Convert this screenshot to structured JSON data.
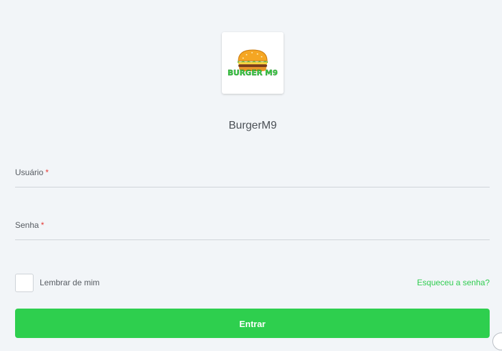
{
  "app": {
    "logo_text": "BURGER M9",
    "title": "BurgerM9"
  },
  "form": {
    "username": {
      "label": "Usuário",
      "required_mark": "*",
      "value": ""
    },
    "password": {
      "label": "Senha",
      "required_mark": "*",
      "value": ""
    },
    "remember_label": "Lembrar de mim",
    "remember_checked": false,
    "forgot_link": "Esqueceu a senha?",
    "submit_label": "Entrar"
  },
  "colors": {
    "accent": "#2ecf4e",
    "background": "#f2f5f8",
    "required": "#e53935"
  }
}
